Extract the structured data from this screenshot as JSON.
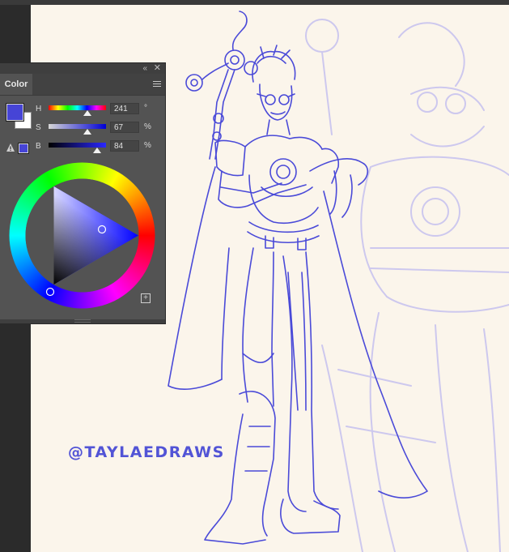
{
  "panel": {
    "collapse_glyph": "«",
    "close_glyph": "✕",
    "tab_label": "Color",
    "menu_icon": "panel-menu-icon",
    "add_icon_glyph": "+"
  },
  "color": {
    "foreground_hex": "#4644d6",
    "background_hex": "#ffffff",
    "sliders": [
      {
        "label": "H",
        "value": "241",
        "unit": "°",
        "fraction": 0.67
      },
      {
        "label": "S",
        "value": "67",
        "unit": "%",
        "fraction": 0.67
      },
      {
        "label": "B",
        "value": "84",
        "unit": "%",
        "fraction": 0.84
      }
    ],
    "warning_icon": "gamut-warning-icon"
  },
  "canvas": {
    "watermark": "@TAYLAEDRAWS",
    "sketch_color": "#4a4ad8",
    "ghost_sketch_color": "#c9c4ec",
    "paper_color": "#fbf5eb"
  }
}
